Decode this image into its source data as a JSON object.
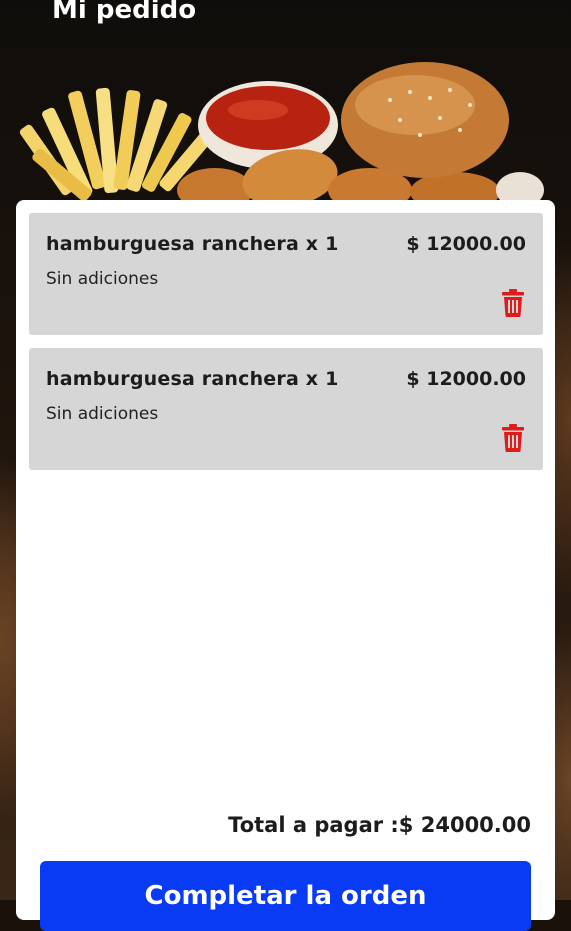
{
  "header": {
    "title": "Mi pedido"
  },
  "order": {
    "items": [
      {
        "name": "hamburguesa ranchera x 1",
        "price": "$ 12000.00",
        "additions": "Sin adiciones"
      },
      {
        "name": "hamburguesa ranchera x 1",
        "price": "$ 12000.00",
        "additions": "Sin adiciones"
      }
    ],
    "total_label": "Total a pagar :$ 24000.00"
  },
  "actions": {
    "complete_label": "Completar la orden"
  },
  "icons": {
    "delete": "trash-icon"
  },
  "colors": {
    "primary_button": "#0a3bf4",
    "delete_icon": "#e01b1b",
    "item_background": "#d6d6d6"
  }
}
